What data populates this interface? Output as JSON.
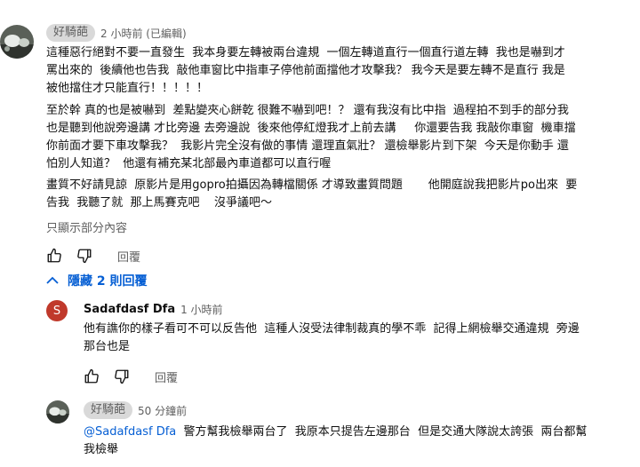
{
  "comment": {
    "author": "好騎葩",
    "time": "2 小時前 (已編輯)",
    "paragraphs": [
      "這種惡行絕對不要一直發生  我本身要左轉被兩台違規  一個左轉道直行一個直行道左轉  我也是嚇到才\n罵出來的  後續他也告我  敲他車窗比中指車子停他前面擋他才攻擊我？ 我今天是要左轉不是直行 我是\n被他擋住才只能直行！！！！！",
      "至於幹 真的也是被嚇到  差點變夾心餅乾 很難不嚇到吧！？ 還有我沒有比中指  過程拍不到手的部分我\n也是聽到他說旁邊講 才比旁邊 去旁邊說  後來他停紅燈我才上前去講     你還要告我 我敲你車窗  機車擋\n你前面才要下車攻擊我？  我影片完全沒有做的事情 還理直氣壯？ 還檢舉影片到下架  今天是你動手 還\n怕別人知道？  他還有補充某北部最內車道都可以直行喔",
      "畫質不好請見諒  原影片是用gopro拍攝因為轉檔關係 才導致畫質問題       他開庭說我把影片po出來  要\n告我  我聽了就  那上馬賽克吧    沒爭議吧～"
    ],
    "read_more": "只顯示部分內容",
    "reply_label": "回覆"
  },
  "replies_toggle": {
    "label": "隱藏 2 則回覆"
  },
  "reply1": {
    "avatar_letter": "S",
    "author": "Sadafdasf Dfa",
    "time": "1 小時前",
    "text": "他有譙你的樣子看可不可以反告他  這種人沒受法律制裁真的學不乖  記得上網檢舉交通違規  旁邊\n那台也是",
    "reply_label": "回覆"
  },
  "reply2": {
    "author": "好騎葩",
    "time": "50 分鐘前",
    "mention": "@Sadafdasf Dfa",
    "text": "  警方幫我檢舉兩台了  我原本只提告左邊那台  但是交通大隊說太誇張  兩台都幫\n我檢舉"
  },
  "colors": {
    "link_blue": "#065fd4",
    "avatar_s_red": "#c0392b",
    "pill_bg": "#d9d9d9",
    "meta_grey": "#606060"
  },
  "icons": [
    "thumbs-up-icon",
    "thumbs-down-icon",
    "chevron-up-icon"
  ]
}
